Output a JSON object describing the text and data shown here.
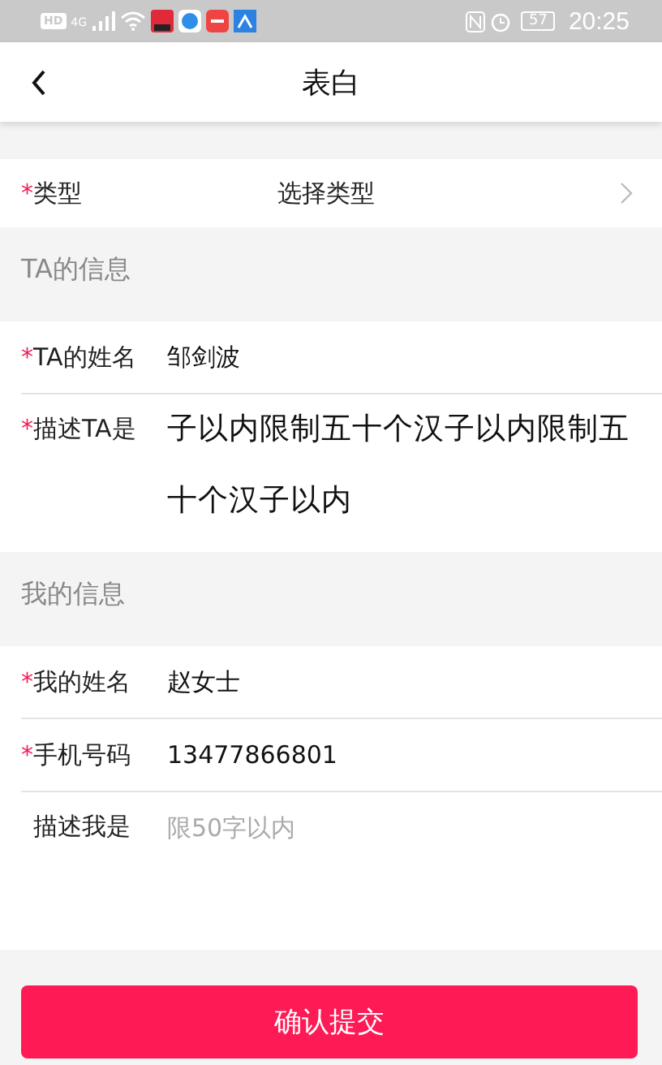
{
  "status_bar": {
    "hd": "HD",
    "network": "4G",
    "battery": "57",
    "time": "20:25"
  },
  "header": {
    "title": "表白"
  },
  "required_mark": "*",
  "type_row": {
    "label": "类型",
    "required": true,
    "value": "选择类型"
  },
  "sections": [
    {
      "title": "TA的信息",
      "fields": [
        {
          "kind": "input",
          "label": "TA的姓名",
          "required": true,
          "value": "邹剑波"
        },
        {
          "kind": "textarea",
          "label": "描述TA是",
          "required": true,
          "value": "子以内限制五十个汉子以内限制五十个汉子以内"
        }
      ]
    },
    {
      "title": "我的信息",
      "fields": [
        {
          "kind": "input",
          "label": "我的姓名",
          "required": true,
          "value": "赵女士"
        },
        {
          "kind": "input",
          "label": "手机号码",
          "required": true,
          "value": "13477866801"
        },
        {
          "kind": "textarea",
          "label": "描述我是",
          "required": false,
          "placeholder": "限50字以内"
        }
      ]
    }
  ],
  "submit": "确认提交"
}
